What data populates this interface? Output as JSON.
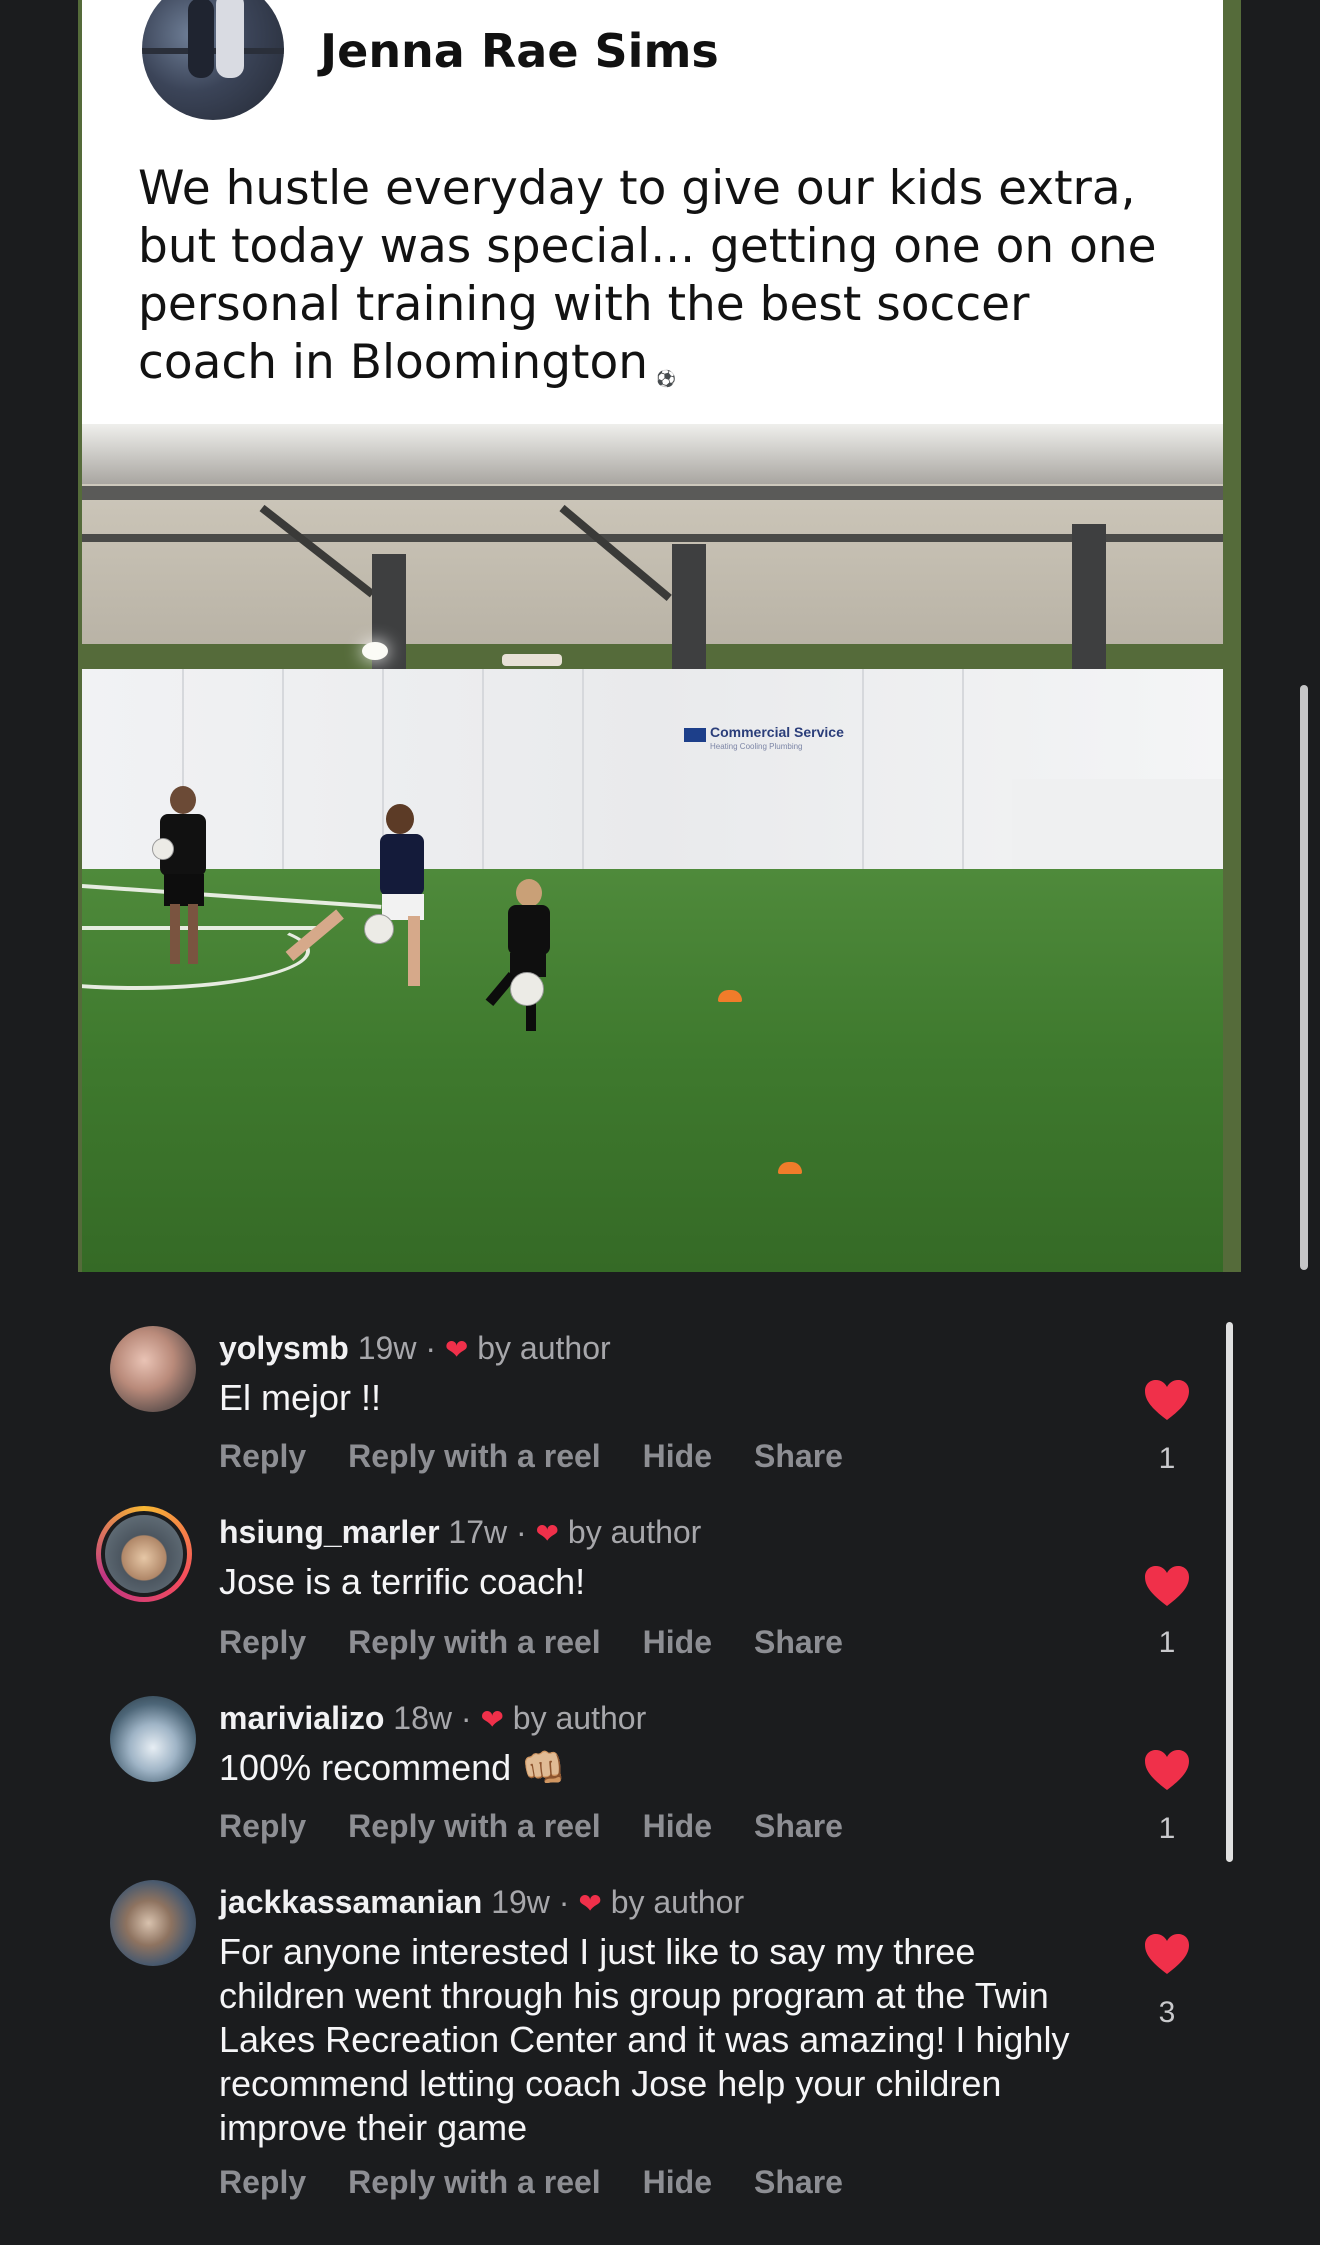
{
  "post": {
    "author": "Jenna Rae Sims",
    "caption": "We hustle everyday to give our kids extra, but today was special... getting one on one personal training with the best soccer coach in Bloomington",
    "caption_emoji": "⚽",
    "photo_sign_title": "Commercial Service",
    "photo_sign_sub": "Heating  Cooling  Plumbing"
  },
  "labels": {
    "reply": "Reply",
    "reply_reel": "Reply with a reel",
    "hide": "Hide",
    "share": "Share",
    "by_author": "by author"
  },
  "comments": [
    {
      "username": "yolysmb",
      "age": "19w",
      "text": "El mejor !!",
      "likes": "1"
    },
    {
      "username": "hsiung_marler",
      "age": "17w",
      "text": "Jose is a terrific coach!",
      "likes": "1"
    },
    {
      "username": "marivializo",
      "age": "18w",
      "text": "100% recommend 👊🏼",
      "likes": "1"
    },
    {
      "username": "jackkassamanian",
      "age": "19w",
      "text": "For anyone interested I just like to say my three children went through his group program at the Twin Lakes Recreation Center and it was amazing! I highly recommend letting coach Jose help your children improve their game",
      "likes": "3"
    }
  ],
  "colors": {
    "background": "#1b1c1e",
    "like_red": "#f0304a",
    "action_gray": "#8d8e93"
  }
}
